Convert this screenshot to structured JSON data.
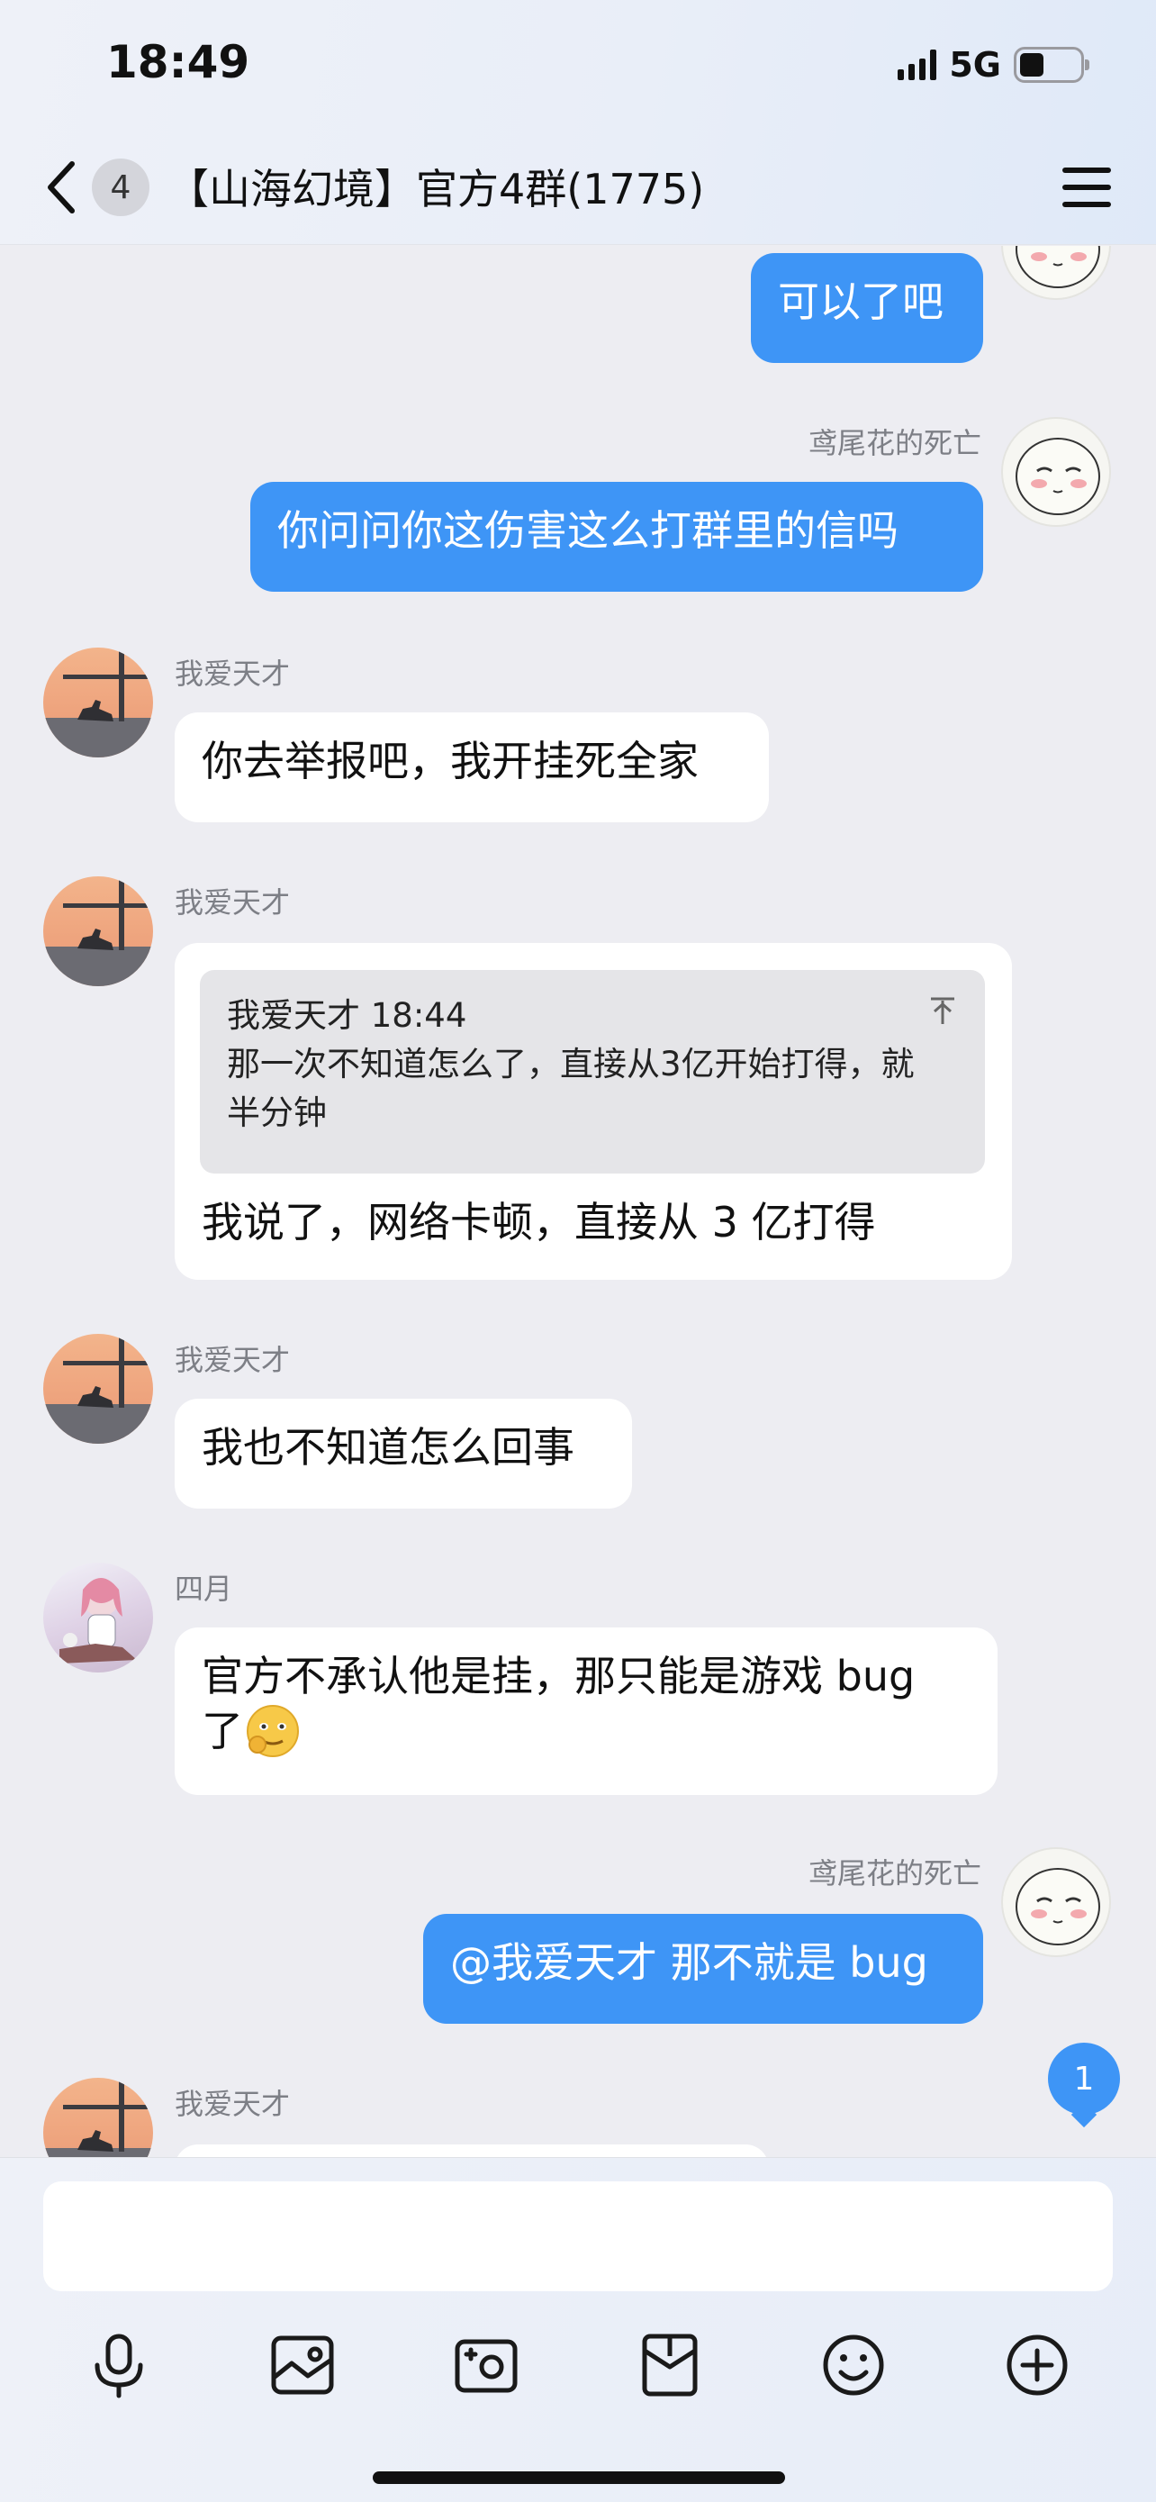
{
  "status_bar": {
    "time": "18:49",
    "network": "5G"
  },
  "header": {
    "unread_count": "4",
    "title": "【山海幻境】官方4群(1775)"
  },
  "messages": [
    {
      "sender": "",
      "text": "可以了吧"
    },
    {
      "sender": "鸢尾花的死亡",
      "text": "你问问你这伤害这么打群里的信吗"
    },
    {
      "sender": "我爱天才",
      "text": "你去举报吧，我开挂死全家"
    },
    {
      "sender": "我爱天才",
      "quote": {
        "header": "我爱天才 18:44",
        "line1": "那一次不知道怎么了，直接从3亿开始打得，就",
        "line2": "半分钟"
      },
      "text": "我说了，网络卡顿，直接从 3 亿打得"
    },
    {
      "sender": "我爱天才",
      "text": "我也不知道怎么回事"
    },
    {
      "sender": "四月",
      "line1": "官方不承认他是挂，那只能是游戏 bug",
      "line2": "了"
    },
    {
      "sender": "鸢尾花的死亡",
      "text": "@我爱天才 那不就是 bug"
    },
    {
      "sender": "我爱天才",
      "text": ""
    }
  ],
  "new_message_badge": "1",
  "input": {
    "placeholder": ""
  },
  "icons": {
    "back": "chevron-left-icon",
    "menu": "hamburger-menu-icon",
    "toolbar": [
      "microphone-icon",
      "image-icon",
      "camera-icon",
      "red-packet-icon",
      "emoji-icon",
      "plus-icon"
    ]
  },
  "colors": {
    "outgoing_bubble": "#3e95f6",
    "incoming_bubble": "#ffffff",
    "background": "#ededf2"
  }
}
